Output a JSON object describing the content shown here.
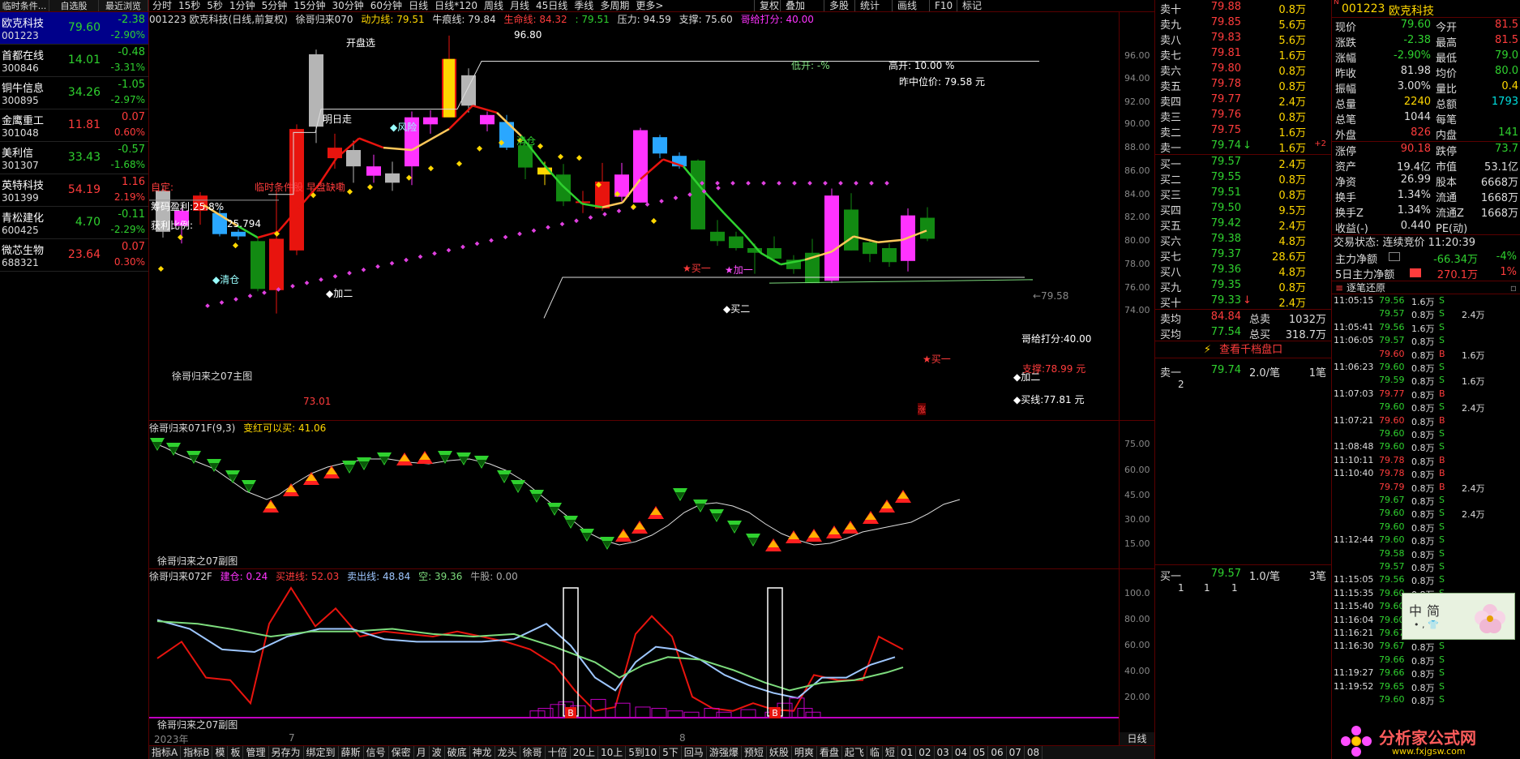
{
  "left_panel": {
    "headers": [
      "临时条件...",
      "自选股",
      "最近浏览"
    ],
    "stocks": [
      {
        "name": "欧克科技",
        "code": "001223",
        "price": "79.60",
        "change": "-2.38",
        "pct": "-2.90%",
        "dir": "dn"
      },
      {
        "name": "首都在线",
        "code": "300846",
        "price": "14.01",
        "change": "-0.48",
        "pct": "-3.31%",
        "dir": "dn"
      },
      {
        "name": "铜牛信息",
        "code": "300895",
        "price": "34.26",
        "change": "-1.05",
        "pct": "-2.97%",
        "dir": "dn"
      },
      {
        "name": "金鹰重工",
        "code": "301048",
        "price": "11.81",
        "change": "0.07",
        "pct": "0.60%",
        "dir": "up"
      },
      {
        "name": "美利信",
        "code": "301307",
        "price": "33.43",
        "change": "-0.57",
        "pct": "-1.68%",
        "dir": "dn"
      },
      {
        "name": "英特科技",
        "code": "301399",
        "price": "54.19",
        "change": "1.16",
        "pct": "2.19%",
        "dir": "up"
      },
      {
        "name": "青松建化",
        "code": "600425",
        "price": "4.70",
        "change": "-0.11",
        "pct": "-2.29%",
        "dir": "dn"
      },
      {
        "name": "微芯生物",
        "code": "688321",
        "price": "23.64",
        "change": "0.07",
        "pct": "0.30%",
        "dir": "up"
      }
    ]
  },
  "top_tabs": [
    "分时",
    "15秒",
    "5秒",
    "1分钟",
    "5分钟",
    "15分钟",
    "30分钟",
    "60分钟",
    "日线",
    "日线*120",
    "周线",
    "月线",
    "45日线",
    "季线",
    "多周期",
    "更多>"
  ],
  "top_right_tabs": [
    "复权",
    "叠加",
    "多股",
    "统计",
    "画线",
    "F10",
    "标记"
  ],
  "main_info": {
    "title": "001223 欧克科技(日线,前复权)",
    "indicator": "徐哥归来070",
    "dongli": "动力线: 79.51",
    "niuhen": "牛痕线: 79.84",
    "shengming": "生命线: 84.32",
    "val79": ": 79.51",
    "yali": "压力: 94.59",
    "zhicheng": "支撑: 75.60",
    "gege": "哥给打分: 40.00"
  },
  "main_labels": {
    "kaipan": "开盘选",
    "mingri": "明日走",
    "fengxian": "◆风险",
    "zixuan": "自定:",
    "linshi": "临时条件股 早盘缺嘞",
    "choumai": "筹码盈利:25.8%",
    "huoli_k": "获利比例:",
    "huoli_v": "25.794",
    "qingcang1": "◆清仓",
    "jiaer1": "◆加二",
    "qingcang2": "清仓",
    "maiyi1": "★买一",
    "jiayi": "★加一",
    "maier": "◆买二",
    "maiyi2": "★买一",
    "zhouzhu": "徐哥归来之07主图",
    "high": "96.80",
    "low": "73.01",
    "cangkai": "低开: -%",
    "gaokai": "高开: 10.00 %",
    "zuozhong": "昨中位价: 79.58 元",
    "arrow": "←79.58",
    "gegei2": "哥给打分:40.00",
    "zhicheng2": "支撑:78.99 元",
    "jiaer2": "◆加二",
    "maixian": "◆买线:77.81 元",
    "zhang": "涨"
  },
  "y_ticks_main": [
    "96.00",
    "94.00",
    "92.00",
    "90.00",
    "88.00",
    "86.00",
    "84.00",
    "82.00",
    "80.00",
    "78.00",
    "76.00",
    "74.00"
  ],
  "sub1_info": {
    "title": "徐哥归来071F(9,3)",
    "val": "变红可以买: 41.06",
    "foot": "徐哥归来之07副图"
  },
  "y_ticks_sub1": [
    "75.00",
    "60.00",
    "45.00",
    "30.00",
    "15.00"
  ],
  "sub2_info": {
    "title": "徐哥归来072F",
    "jiancang": "建仓: 0.24",
    "maijin": "买进线: 52.03",
    "maichu": "卖出线: 48.84",
    "kong": "空: 39.36",
    "niugu": "牛股: 0.00",
    "foot": "徐哥归来之07副图"
  },
  "y_ticks_sub2": [
    "100.0",
    "80.00",
    "60.00",
    "40.00",
    "20.00"
  ],
  "x_dates": [
    "2023年",
    "7",
    "8"
  ],
  "bottom_tabs": [
    "指标A",
    "指标B",
    "模",
    "板",
    "管理",
    "另存为",
    "绑定到",
    "薛斯",
    "信号",
    "保密",
    "月",
    "波",
    "破底",
    "神龙",
    "龙头",
    "徐哥",
    "十倍",
    "20上",
    "10上",
    "5到10",
    "5下",
    "回马",
    "游强爆",
    "预短",
    "妖股",
    "明爽",
    "看盘",
    "起飞",
    "临",
    "短",
    "01",
    "02",
    "03",
    "04",
    "05",
    "06",
    "07",
    "08"
  ],
  "bottom_right": "日线",
  "order_book": {
    "asks": [
      {
        "label": "卖十",
        "price": "79.88",
        "vol": "0.8万",
        "dir": "up"
      },
      {
        "label": "卖九",
        "price": "79.85",
        "vol": "5.6万",
        "dir": "up"
      },
      {
        "label": "卖八",
        "price": "79.83",
        "vol": "5.6万",
        "dir": "up"
      },
      {
        "label": "卖七",
        "price": "79.81",
        "vol": "1.6万",
        "dir": "up"
      },
      {
        "label": "卖六",
        "price": "79.80",
        "vol": "0.8万",
        "dir": "up"
      },
      {
        "label": "卖五",
        "price": "79.78",
        "vol": "0.8万",
        "dir": "up"
      },
      {
        "label": "卖四",
        "price": "79.77",
        "vol": "2.4万",
        "dir": "up"
      },
      {
        "label": "卖三",
        "price": "79.76",
        "vol": "0.8万",
        "dir": "up"
      },
      {
        "label": "卖二",
        "price": "79.75",
        "vol": "1.6万",
        "dir": "up"
      },
      {
        "label": "卖一",
        "price": "79.74",
        "vol": "1.6万",
        "dir": "dn",
        "arrow": "↓",
        "extra": "+2"
      }
    ],
    "bids": [
      {
        "label": "买一",
        "price": "79.57",
        "vol": "2.4万",
        "dir": "dn"
      },
      {
        "label": "买二",
        "price": "79.55",
        "vol": "0.8万",
        "dir": "dn"
      },
      {
        "label": "买三",
        "price": "79.51",
        "vol": "0.8万",
        "dir": "dn"
      },
      {
        "label": "买四",
        "price": "79.50",
        "vol": "9.5万",
        "dir": "dn"
      },
      {
        "label": "买五",
        "price": "79.42",
        "vol": "2.4万",
        "dir": "dn"
      },
      {
        "label": "买六",
        "price": "79.38",
        "vol": "4.8万",
        "dir": "dn"
      },
      {
        "label": "买七",
        "price": "79.37",
        "vol": "28.6万",
        "dir": "dn"
      },
      {
        "label": "买八",
        "price": "79.36",
        "vol": "4.8万",
        "dir": "dn"
      },
      {
        "label": "买九",
        "price": "79.35",
        "vol": "0.8万",
        "dir": "dn"
      },
      {
        "label": "买十",
        "price": "79.33",
        "vol": "2.4万",
        "dir": "dn",
        "arrow": "↓"
      }
    ],
    "maijun": {
      "label": "卖均",
      "price": "84.84",
      "k": "总卖",
      "v": "1032万"
    },
    "mjun": {
      "label": "买均",
      "price": "77.54",
      "k": "总买",
      "v": "318.7万"
    },
    "link": "查看千档盘口",
    "sell1": {
      "label": "卖一",
      "price": "79.74",
      "vol": "2.0/笔",
      "count": "1笔",
      "detail": "2"
    },
    "buy1": {
      "label": "买一",
      "price": "79.57",
      "vol": "1.0/笔",
      "count": "3笔",
      "detail": [
        "1",
        "1",
        "1"
      ]
    }
  },
  "quote": {
    "flag": "N",
    "code": "001223",
    "name": "欧克科技",
    "rows": [
      [
        "现价",
        "79.60",
        "dn",
        "今开",
        "81.5",
        "up"
      ],
      [
        "涨跌",
        "-2.38",
        "dn",
        "最高",
        "81.5",
        "up"
      ],
      [
        "涨幅",
        "-2.90%",
        "dn",
        "最低",
        "79.0",
        "dn"
      ],
      [
        "昨收",
        "81.98",
        "wh",
        "均价",
        "80.0",
        "dn"
      ],
      [
        "振幅",
        "3.00%",
        "wh",
        "量比",
        "0.4",
        "yl"
      ],
      [
        "总量",
        "2240",
        "yl",
        "总额",
        "1793",
        "cy"
      ],
      [
        "总笔",
        "1044",
        "wh",
        "每笔",
        "",
        "wh"
      ],
      [
        "外盘",
        "826",
        "up",
        "内盘",
        "141",
        "dn"
      ]
    ],
    "rows2": [
      [
        "涨停",
        "90.18",
        "up",
        "跌停",
        "73.7",
        "dn"
      ],
      [
        "资产",
        "19.4亿",
        "wh",
        "市值",
        "53.1亿",
        "wh"
      ],
      [
        "净资",
        "26.99",
        "wh",
        "股本",
        "6668万",
        "wh"
      ],
      [
        "换手",
        "1.34%",
        "wh",
        "流通",
        "1668万",
        "wh"
      ],
      [
        "换手Z",
        "1.34%",
        "wh",
        "流通Z",
        "1668万",
        "wh"
      ],
      [
        "收益(-)",
        "0.440",
        "wh",
        "PE(动)",
        "",
        "wh"
      ]
    ],
    "status": "交易状态: 连续竞价 11:20:39",
    "zhuli": {
      "label": "主力净额",
      "val": "-66.34万",
      "pct": "-4%"
    },
    "zhuli5": {
      "label": "5日主力净额",
      "val": "270.1万",
      "pct": "1%"
    },
    "zhubi": "逐笔还原",
    "ticks": [
      [
        "11:05:15",
        "79.56",
        "1.6万",
        "S",
        ""
      ],
      [
        "",
        "79.57",
        "0.8万",
        "S",
        "2.4万"
      ],
      [
        "11:05:41",
        "79.56",
        "1.6万",
        "S",
        ""
      ],
      [
        "11:06:05",
        "79.57",
        "0.8万",
        "S",
        ""
      ],
      [
        "",
        "79.60",
        "0.8万",
        "B",
        "1.6万"
      ],
      [
        "11:06:23",
        "79.60",
        "0.8万",
        "S",
        ""
      ],
      [
        "",
        "79.59",
        "0.8万",
        "S",
        "1.6万"
      ],
      [
        "11:07:03",
        "79.77",
        "0.8万",
        "B",
        ""
      ],
      [
        "",
        "79.60",
        "0.8万",
        "S",
        "2.4万"
      ],
      [
        "11:07:21",
        "79.60",
        "0.8万",
        "B",
        ""
      ],
      [
        "",
        "79.60",
        "0.8万",
        "S",
        ""
      ],
      [
        "11:08:48",
        "79.60",
        "0.8万",
        "S",
        ""
      ],
      [
        "11:10:11",
        "79.78",
        "0.8万",
        "B",
        ""
      ],
      [
        "11:10:40",
        "79.78",
        "0.8万",
        "B",
        ""
      ],
      [
        "",
        "79.79",
        "0.8万",
        "B",
        "2.4万"
      ],
      [
        "",
        "79.67",
        "0.8万",
        "S",
        ""
      ],
      [
        "",
        "79.60",
        "0.8万",
        "S",
        "2.4万"
      ],
      [
        "",
        "79.60",
        "0.8万",
        "S",
        ""
      ],
      [
        "11:12:44",
        "79.60",
        "0.8万",
        "S",
        ""
      ],
      [
        "",
        "79.58",
        "0.8万",
        "S",
        ""
      ],
      [
        "",
        "79.57",
        "0.8万",
        "S",
        ""
      ],
      [
        "11:15:05",
        "79.56",
        "0.8万",
        "S",
        ""
      ],
      [
        "11:15:35",
        "79.60",
        "0.8万",
        "S",
        ""
      ],
      [
        "11:15:40",
        "79.60",
        "0.8万",
        "S",
        ""
      ],
      [
        "11:16:04",
        "79.60",
        "0.8万",
        "S",
        ""
      ],
      [
        "11:16:21",
        "79.67",
        "0.8万",
        "S",
        ""
      ],
      [
        "11:16:30",
        "79.67",
        "0.8万",
        "S",
        ""
      ],
      [
        "",
        "79.66",
        "0.8万",
        "S",
        ""
      ],
      [
        "11:19:27",
        "79.66",
        "0.8万",
        "S",
        ""
      ],
      [
        "11:19:52",
        "79.65",
        "0.8万",
        "S",
        ""
      ],
      [
        "",
        "79.60",
        "0.8万",
        "S",
        ""
      ]
    ],
    "widget": {
      "a": "中",
      "b": "简"
    },
    "watermark": "分析家公式网",
    "watermark_url": "www.fxjgsw.com"
  },
  "colors": {
    "up": "#ff3c3c",
    "down": "#2fd12f",
    "magenta": "#ff33ff",
    "blue": "#2aa7ff",
    "gray": "#a0a0a0"
  }
}
